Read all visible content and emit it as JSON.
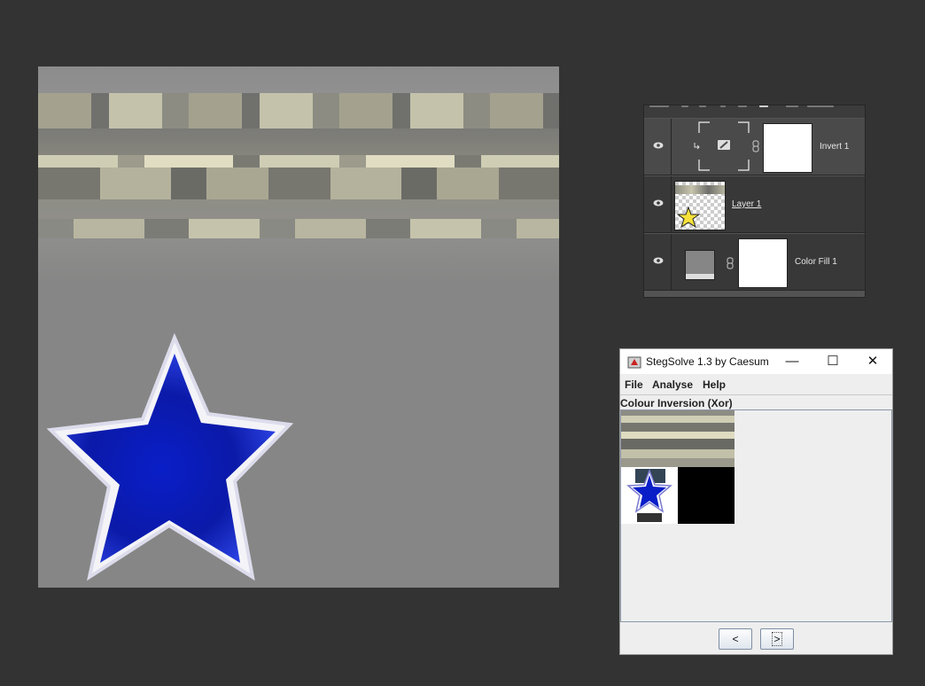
{
  "layers_panel": {
    "layers": [
      {
        "name": "Invert 1",
        "type": "adjustment",
        "visible": true,
        "selected": true
      },
      {
        "name": "Layer 1",
        "type": "pixel",
        "visible": true,
        "selected": false
      },
      {
        "name": "Color Fill 1",
        "type": "fill",
        "visible": true,
        "selected": false
      }
    ]
  },
  "stegsolve": {
    "title": "StegSolve 1.3 by Caesum",
    "window_controls": {
      "minimize": "—",
      "maximize": "☐",
      "close": "✕"
    },
    "menu": [
      "File",
      "Analyse",
      "Help"
    ],
    "mode_label": "Colour Inversion (Xor)",
    "prev_label": "<",
    "next_label": ">"
  },
  "colors": {
    "canvas_gray": "#868686",
    "star_blue": "#0a1ec8",
    "star_outline": "#ffffff",
    "panel_bg": "#383838",
    "window_bg": "#eeeeee"
  }
}
